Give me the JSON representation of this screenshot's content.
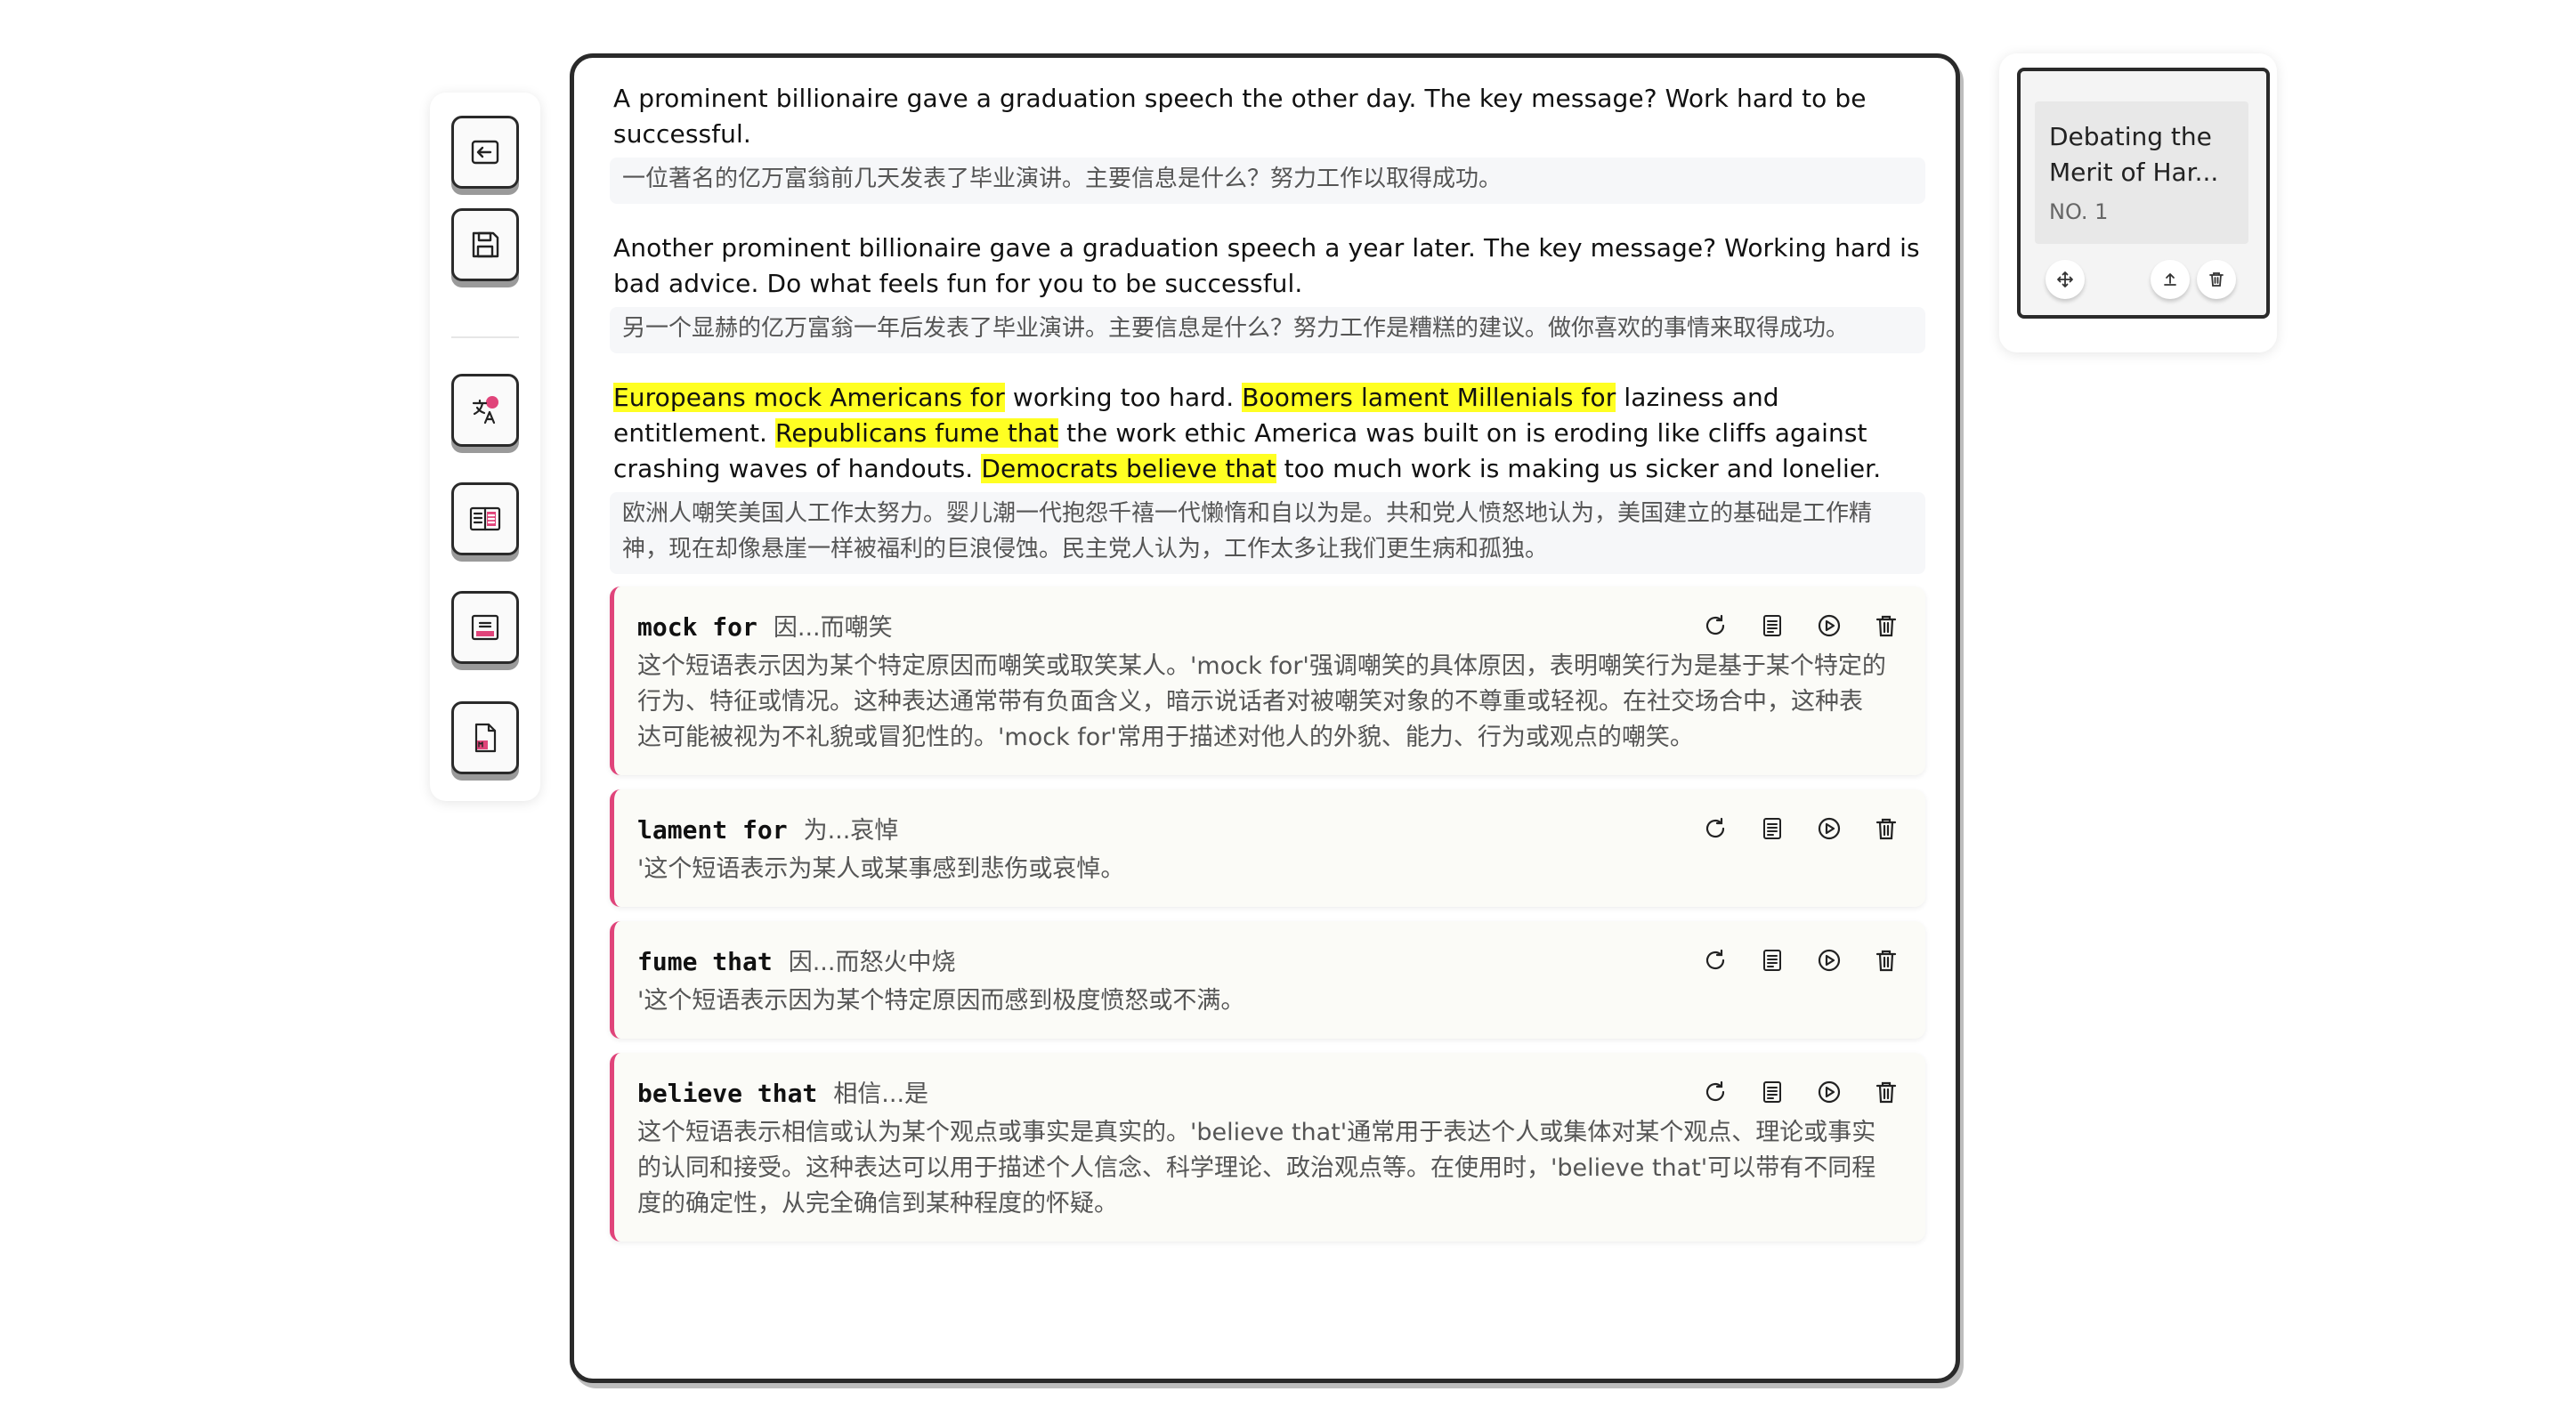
{
  "paragraphs": [
    {
      "en": [
        "A prominent billionaire gave a graduation speech the other day. The key message? Work hard to be successful."
      ],
      "zh": "一位著名的亿万富翁前几天发表了毕业演讲。主要信息是什么？努力工作以取得成功。"
    },
    {
      "en": [
        "Another prominent billionaire gave a graduation speech a year later. The key message? Working hard is bad advice. Do what feels fun for you to be successful."
      ],
      "zh": "另一个显赫的亿万富翁一年后发表了毕业演讲。主要信息是什么？努力工作是糟糕的建议。做你喜欢的事情来取得成功。"
    },
    {
      "segments": [
        {
          "t": "Europeans mock Americans for",
          "hl": true
        },
        {
          "t": " working too hard. ",
          "hl": false
        },
        {
          "t": "Boomers lament Millenials for",
          "hl": true
        },
        {
          "t": " laziness and entitlement. ",
          "hl": false
        },
        {
          "t": "Republicans fume that",
          "hl": true
        },
        {
          "t": " the work ethic America was built on is eroding like cliffs against crashing waves of handouts. ",
          "hl": false
        },
        {
          "t": "Democrats believe that",
          "hl": true
        },
        {
          "t": " too much work is making us sicker and lonelier.",
          "hl": false
        }
      ],
      "zh": "欧洲人嘲笑美国人工作太努力。婴儿潮一代抱怨千禧一代懒惰和自以为是。共和党人愤怒地认为，美国建立的基础是工作精神，现在却像悬崖一样被福利的巨浪侵蚀。民主党人认为，工作太多让我们更生病和孤独。"
    }
  ],
  "cards": [
    {
      "term": "mock for",
      "term_zh": "因...而嘲笑",
      "explanation": "这个短语表示因为某个特定原因而嘲笑或取笑某人。'mock for'强调嘲笑的具体原因，表明嘲笑行为是基于某个特定的行为、特征或情况。这种表达通常带有负面含义，暗示说话者对被嘲笑对象的不尊重或轻视。在社交场合中，这种表达可能被视为不礼貌或冒犯性的。'mock for'常用于描述对他人的外貌、能力、行为或观点的嘲笑。"
    },
    {
      "term": "lament for",
      "term_zh": "为...哀悼",
      "explanation": "'这个短语表示为某人或某事感到悲伤或哀悼。"
    },
    {
      "term": "fume that",
      "term_zh": "因...而怒火中烧",
      "explanation": "'这个短语表示因为某个特定原因而感到极度愤怒或不满。"
    },
    {
      "term": "believe that",
      "term_zh": "相信...是",
      "explanation": "这个短语表示相信或认为某个观点或事实是真实的。'believe that'通常用于表达个人或集体对某个观点、理论或事实的认同和接受。这种表达可以用于描述个人信念、科学理论、政治观点等。在使用时，'believe that'可以带有不同程度的确定性，从完全确信到某种程度的怀疑。"
    }
  ],
  "note": {
    "title": "Debating the Merit of Har...",
    "number": "NO. 1"
  },
  "toolbar_icons": [
    "exit-icon",
    "save-icon",
    "translate-icon",
    "book-icon",
    "reader-icon",
    "markdown-file-icon"
  ],
  "colors": {
    "highlight": "#ffff22",
    "accent": "#e0447a",
    "border": "#2a2a2a"
  }
}
